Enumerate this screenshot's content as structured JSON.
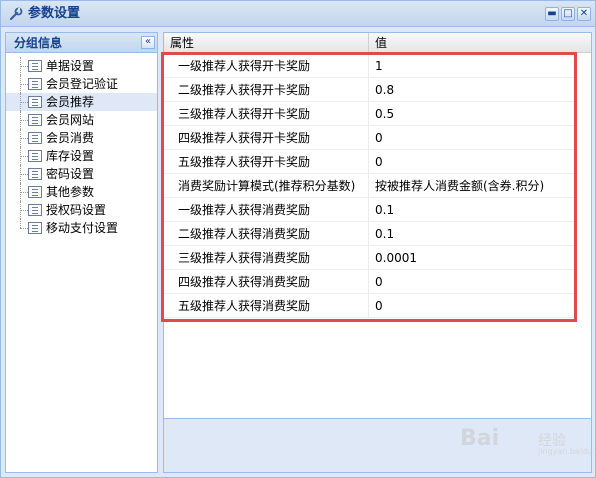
{
  "window": {
    "title": "参数设置",
    "icon": "wrench-icon",
    "buttons": [
      "minimize-icon",
      "maximize-icon",
      "close-icon"
    ]
  },
  "left_panel": {
    "title": "分组信息",
    "items": [
      {
        "label": "单据设置",
        "selected": false
      },
      {
        "label": "会员登记验证",
        "selected": false
      },
      {
        "label": "会员推荐",
        "selected": true
      },
      {
        "label": "会员网站",
        "selected": false
      },
      {
        "label": "会员消费",
        "selected": false
      },
      {
        "label": "库存设置",
        "selected": false
      },
      {
        "label": "密码设置",
        "selected": false
      },
      {
        "label": "其他参数",
        "selected": false
      },
      {
        "label": "授权码设置",
        "selected": false
      },
      {
        "label": "移动支付设置",
        "selected": false
      }
    ]
  },
  "grid": {
    "headers": {
      "property": "属性",
      "value": "值"
    },
    "rows": [
      {
        "property": "一级推荐人获得开卡奖励",
        "value": "1"
      },
      {
        "property": "二级推荐人获得开卡奖励",
        "value": "0.8"
      },
      {
        "property": "三级推荐人获得开卡奖励",
        "value": "0.5"
      },
      {
        "property": "四级推荐人获得开卡奖励",
        "value": "0"
      },
      {
        "property": "五级推荐人获得开卡奖励",
        "value": "0"
      },
      {
        "property": "消费奖励计算模式(推荐积分基数)",
        "value": "按被推荐人消费金额(含券.积分)"
      },
      {
        "property": "一级推荐人获得消费奖励",
        "value": "0.1"
      },
      {
        "property": "二级推荐人获得消费奖励",
        "value": "0.1"
      },
      {
        "property": "三级推荐人获得消费奖励",
        "value": "0.0001"
      },
      {
        "property": "四级推荐人获得消费奖励",
        "value": "0"
      },
      {
        "property": "五级推荐人获得消费奖励",
        "value": "0"
      }
    ]
  },
  "watermark": {
    "text": "Bai",
    "text2": "经验",
    "sub": "jingyan.baidu.com"
  },
  "colors": {
    "highlight": "#e04a4a",
    "title": "#15428b",
    "panel_bg": "#dfe8f6"
  }
}
